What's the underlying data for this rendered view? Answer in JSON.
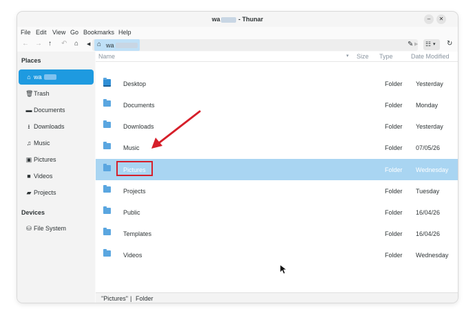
{
  "window": {
    "title_prefix": "wa",
    "title_suffix": "- Thunar"
  },
  "menubar": [
    "File",
    "Edit",
    "View",
    "Go",
    "Bookmarks",
    "Help"
  ],
  "toolbar": {
    "path_segment": "wa"
  },
  "sidebar": {
    "places_header": "Places",
    "home_label": "wa",
    "items": [
      {
        "label": "Trash",
        "icon": "trash-icon"
      },
      {
        "label": "Documents",
        "icon": "document-icon"
      },
      {
        "label": "Downloads",
        "icon": "download-icon"
      },
      {
        "label": "Music",
        "icon": "music-icon"
      },
      {
        "label": "Pictures",
        "icon": "picture-icon"
      },
      {
        "label": "Videos",
        "icon": "video-icon"
      },
      {
        "label": "Projects",
        "icon": "folder-icon"
      }
    ],
    "devices_header": "Devices",
    "device_item": "File System"
  },
  "columns": {
    "name": "Name",
    "size": "Size",
    "type": "Type",
    "date": "Date Modified"
  },
  "files": [
    {
      "name": "Desktop",
      "type": "Folder",
      "date": "Yesterday"
    },
    {
      "name": "Documents",
      "type": "Folder",
      "date": "Monday"
    },
    {
      "name": "Downloads",
      "type": "Folder",
      "date": "Yesterday"
    },
    {
      "name": "Music",
      "type": "Folder",
      "date": "07/05/26"
    },
    {
      "name": "Pictures",
      "type": "Folder",
      "date": "Wednesday"
    },
    {
      "name": "Projects",
      "type": "Folder",
      "date": "Tuesday"
    },
    {
      "name": "Public",
      "type": "Folder",
      "date": "16/04/26"
    },
    {
      "name": "Templates",
      "type": "Folder",
      "date": "16/04/26"
    },
    {
      "name": "Videos",
      "type": "Folder",
      "date": "Wednesday"
    }
  ],
  "statusbar": {
    "selection": "\"Pictures\"",
    "separator": "|",
    "kind": "Folder"
  },
  "colors": {
    "accent": "#1e9ae0",
    "selection": "#a9d5f2",
    "annotation": "#d61f2a"
  }
}
